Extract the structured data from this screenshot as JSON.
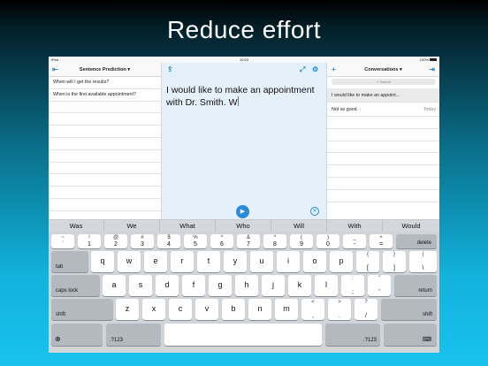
{
  "headline": "Reduce effort",
  "status": {
    "left": "iPad",
    "time": "10:53",
    "battery": "100%"
  },
  "left_pane": {
    "title": "Sentence Prediction",
    "items": [
      "When will I get the results?",
      "When is the first available appointment?"
    ]
  },
  "editor": {
    "text": "I would like to make an appointment with Dr. Smith. W"
  },
  "right_pane": {
    "title": "Conversations",
    "search_placeholder": "Search",
    "items": [
      {
        "text": "I would like to make an appoint...",
        "time": ""
      },
      {
        "text": "Not so good.",
        "time": "Today"
      }
    ]
  },
  "suggestions": [
    "Was",
    "We",
    "What",
    "Who",
    "Will",
    "With",
    "Would"
  ],
  "keyboard": {
    "row1": [
      {
        "top": "~",
        "bot": "`"
      },
      {
        "top": "!",
        "bot": "1"
      },
      {
        "top": "@",
        "bot": "2"
      },
      {
        "top": "#",
        "bot": "3"
      },
      {
        "top": "$",
        "bot": "4"
      },
      {
        "top": "%",
        "bot": "5"
      },
      {
        "top": "^",
        "bot": "6"
      },
      {
        "top": "&",
        "bot": "7"
      },
      {
        "top": "*",
        "bot": "8"
      },
      {
        "top": "(",
        "bot": "9"
      },
      {
        "top": ")",
        "bot": "0"
      },
      {
        "top": "_",
        "bot": "-"
      },
      {
        "top": "+",
        "bot": "="
      }
    ],
    "delete": "delete",
    "tab": "tab",
    "row2": [
      "q",
      "w",
      "e",
      "r",
      "t",
      "y",
      "u",
      "i",
      "o",
      "p"
    ],
    "row2_extra": [
      {
        "top": "{",
        "bot": "["
      },
      {
        "top": "}",
        "bot": "]"
      },
      {
        "top": "|",
        "bot": "\\"
      }
    ],
    "caps": "caps lock",
    "row3": [
      "a",
      "s",
      "d",
      "f",
      "g",
      "h",
      "j",
      "k",
      "l"
    ],
    "row3_extra": [
      {
        "top": ":",
        "bot": ";"
      },
      {
        "top": "\"",
        "bot": "'"
      }
    ],
    "return": "return",
    "shift": "shift",
    "row4": [
      "z",
      "x",
      "c",
      "v",
      "b",
      "n",
      "m"
    ],
    "row4_extra": [
      {
        "top": "<",
        "bot": ","
      },
      {
        "top": ">",
        "bot": "."
      },
      {
        "top": "?",
        "bot": "/"
      }
    ],
    "num": ".?123"
  }
}
